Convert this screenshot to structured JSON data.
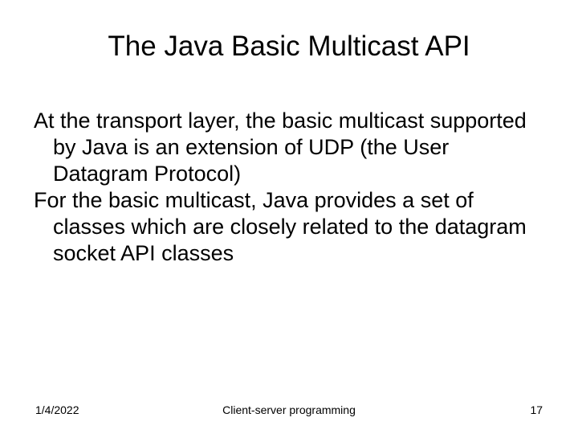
{
  "slide": {
    "title": "The Java Basic Multicast API",
    "paragraphs": [
      "At the transport layer, the basic multicast supported by Java is an extension of UDP (the User Datagram Protocol)",
      "For the basic multicast, Java provides a set of classes which are closely related to the datagram socket API classes"
    ]
  },
  "footer": {
    "date": "1/4/2022",
    "topic": "Client-server programming",
    "page": "17"
  }
}
